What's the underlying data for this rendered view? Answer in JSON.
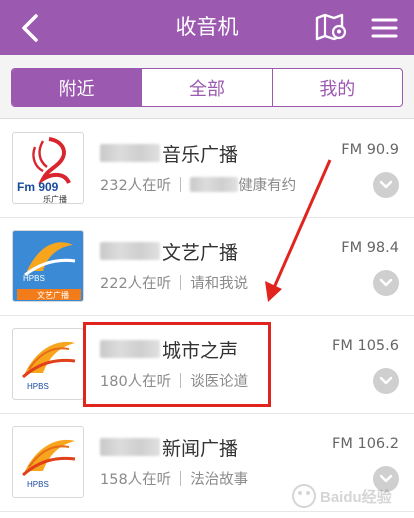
{
  "header": {
    "title": "收音机",
    "back_icon": "chevron-left-icon",
    "map_icon": "map-pin-icon",
    "menu_icon": "hamburger-menu-icon",
    "background": "#9b59b0"
  },
  "tabs": [
    {
      "label": "附近",
      "active": true
    },
    {
      "label": "全部",
      "active": false
    },
    {
      "label": "我的",
      "active": false
    }
  ],
  "stations": [
    {
      "name": "音乐广播",
      "listeners": "232人在听",
      "program": "健康有约",
      "freq": "FM 90.9",
      "logo_text": "Fm 909",
      "logo_sub": "乐广播"
    },
    {
      "name": "文艺广播",
      "listeners": "222人在听",
      "program": "请和我说",
      "freq": "FM 98.4",
      "logo_text": "HPBS",
      "logo_sub": "文艺广播"
    },
    {
      "name": "城市之声",
      "listeners": "180人在听",
      "program": "谈医论道",
      "freq": "FM 105.6",
      "logo_text": "HPBS",
      "logo_sub": ""
    },
    {
      "name": "新闻广播",
      "listeners": "158人在听",
      "program": "法治故事",
      "freq": "FM 106.2",
      "logo_text": "HPBS",
      "logo_sub": ""
    }
  ],
  "accent_color": "#9b59b0",
  "annotation_color": "#e0251f",
  "watermark": "Baidu经验"
}
